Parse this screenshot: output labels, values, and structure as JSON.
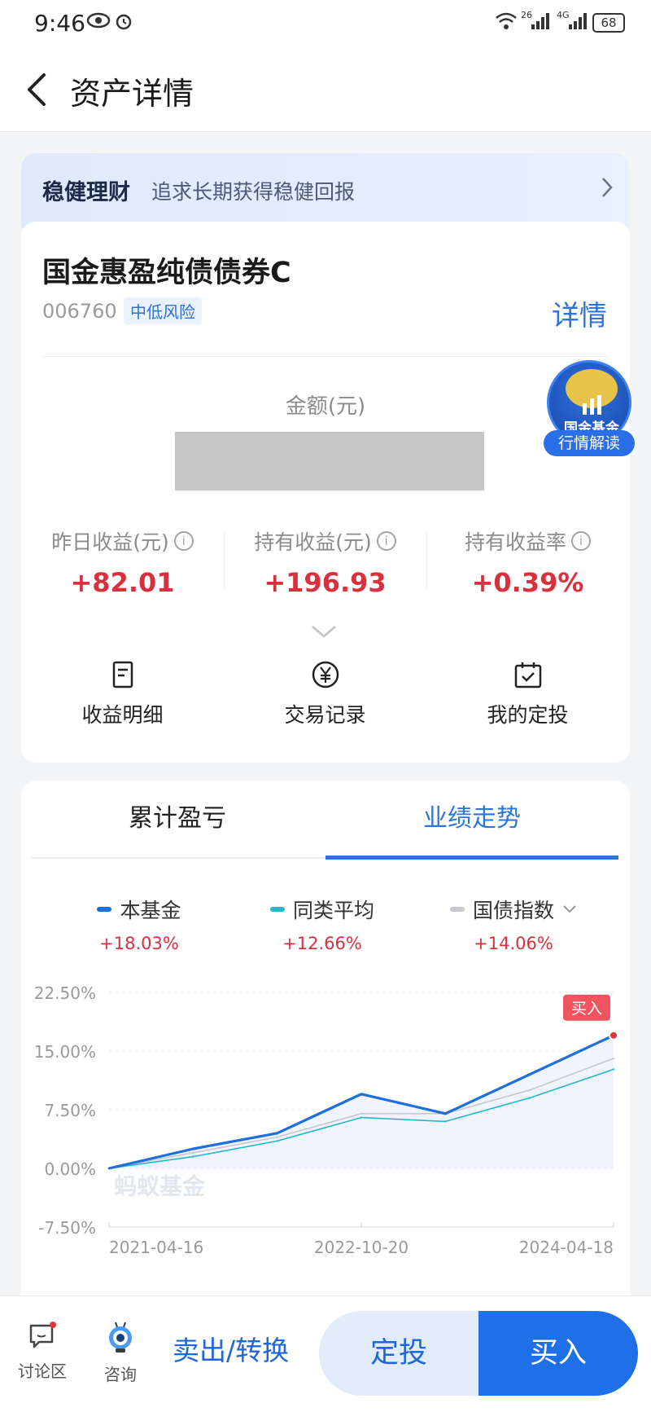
{
  "status": {
    "time": "9:46",
    "battery": "68",
    "net1": "26",
    "net2": "4G"
  },
  "nav": {
    "title": "资产详情"
  },
  "banner": {
    "title": "稳健理财",
    "subtitle": "追求长期获得稳健回报"
  },
  "fund": {
    "name": "国金惠盈纯债债券C",
    "code": "006760",
    "risk": "中低风险",
    "detail_label": "详情"
  },
  "amount": {
    "label": "金额(元)"
  },
  "badge": {
    "name": "国金基金",
    "button": "行情解读"
  },
  "stats": [
    {
      "label": "昨日收益(元)",
      "value": "+82.01"
    },
    {
      "label": "持有收益(元)",
      "value": "+196.93"
    },
    {
      "label": "持有收益率",
      "value": "+0.39%"
    }
  ],
  "quick_actions": [
    {
      "label": "收益明细",
      "icon": "document-icon"
    },
    {
      "label": "交易记录",
      "icon": "yuan-circle-icon"
    },
    {
      "label": "我的定投",
      "icon": "calendar-icon"
    }
  ],
  "tabs": [
    {
      "label": "累计盈亏"
    },
    {
      "label": "业绩走势"
    }
  ],
  "colors": {
    "fund": "#1d6fdc",
    "peer": "#22b8c9",
    "bond": "#c8c8d0",
    "red": "#d9303e",
    "accent": "#2a75d6"
  },
  "chart_data": {
    "type": "line",
    "x": [
      "2021-04-16",
      "2021-10-16",
      "2022-04-16",
      "2022-10-20",
      "2023-04-20",
      "2023-10-20",
      "2024-04-18"
    ],
    "xticks": [
      "2021-04-16",
      "2022-10-20",
      "2024-04-18"
    ],
    "yticks": [
      "22.50%",
      "15.00%",
      "7.50%",
      "0.00%",
      "-7.50%"
    ],
    "ylim": [
      -7.5,
      22.5
    ],
    "series": [
      {
        "name": "本基金",
        "change": "+18.03%",
        "values": [
          0.0,
          2.5,
          4.5,
          9.5,
          7.0,
          12.0,
          17.0
        ]
      },
      {
        "name": "同类平均",
        "change": "+12.66%",
        "values": [
          0.0,
          1.5,
          3.5,
          6.5,
          6.0,
          9.0,
          12.66
        ]
      },
      {
        "name": "国债指数",
        "change": "+14.06%",
        "values": [
          0.0,
          2.0,
          4.0,
          7.0,
          7.0,
          10.0,
          14.06
        ]
      }
    ],
    "marker_label": "买入",
    "watermark": "蚂蚁基金"
  },
  "bottom": {
    "discuss": "讨论区",
    "consult": "咨询",
    "sell": "卖出/转换",
    "fixed": "定投",
    "buy": "买入"
  }
}
